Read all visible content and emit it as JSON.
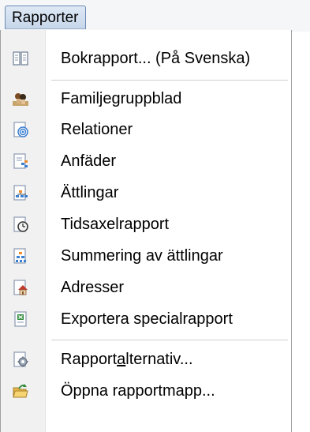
{
  "menu": {
    "title": "Rapporter"
  },
  "items": [
    {
      "label": "Bokrapport... (På Svenska)",
      "icon": "book-icon"
    },
    {
      "label": "Familjegruppblad",
      "icon": "family-group-icon"
    },
    {
      "label": "Relationer",
      "icon": "relations-target-icon"
    },
    {
      "label": "Anfäder",
      "icon": "ancestors-chart-icon"
    },
    {
      "label": "Ättlingar",
      "icon": "descendants-chart-icon"
    },
    {
      "label": "Tidsaxelrapport",
      "icon": "timeline-clock-icon"
    },
    {
      "label": "Summering av ättlingar",
      "icon": "descendant-summary-icon"
    },
    {
      "label": "Adresser",
      "icon": "address-house-icon"
    },
    {
      "label": "Exportera specialrapport",
      "icon": "export-spreadsheet-icon"
    },
    {
      "label_pre": "Rapport",
      "label_ul": "a",
      "label_post": "lternativ...",
      "icon": "report-options-gear-icon"
    },
    {
      "label": "Öppna rapportmapp...",
      "icon": "open-report-folder-icon"
    }
  ]
}
